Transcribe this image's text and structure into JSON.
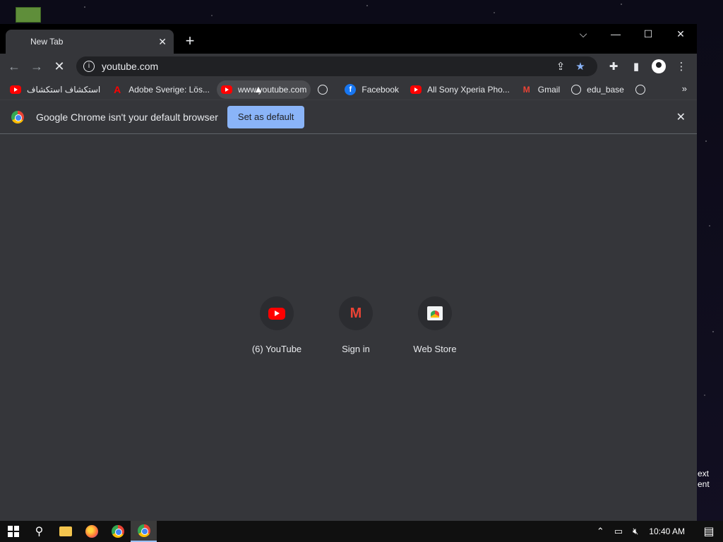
{
  "tab": {
    "title": "New Tab",
    "close": "✕"
  },
  "newtab": "+",
  "window_controls": {
    "menu": "⌵",
    "minimize": "—",
    "maximize": "☐",
    "close": "✕"
  },
  "nav": {
    "back": "←",
    "forward": "→",
    "stop": "✕"
  },
  "omnibox": {
    "url": "youtube.com"
  },
  "bookmarks": [
    {
      "label": "استکشاف استکشاف",
      "icon": "youtube-icon"
    },
    {
      "label": "Adobe Sverige: Lös...",
      "icon": "adobe-icon"
    },
    {
      "label": "www.youtube.com",
      "icon": "youtube-icon"
    },
    {
      "label": "",
      "icon": "globe-icon"
    },
    {
      "label": "Facebook",
      "icon": "facebook-icon"
    },
    {
      "label": "All Sony Xperia Pho...",
      "icon": "youtube-icon"
    },
    {
      "label": "Gmail",
      "icon": "gmail-icon"
    },
    {
      "label": "edu_base",
      "icon": "globe-icon"
    },
    {
      "label": "",
      "icon": "globe-icon"
    }
  ],
  "bookmarks_more": "»",
  "infobar": {
    "message": "Google Chrome isn't your default browser",
    "button": "Set as default",
    "close": "✕"
  },
  "shortcuts": [
    {
      "label": "(6) YouTube",
      "icon": "youtube-icon"
    },
    {
      "label": "Sign in",
      "icon": "gmail-icon"
    },
    {
      "label": "Web Store",
      "icon": "web-store-icon"
    }
  ],
  "taskbar": {
    "clock": "10:40 AM"
  },
  "desktop_peek": [
    "ext",
    "ent"
  ],
  "colors": {
    "accent": "#8ab4f8",
    "surface": "#35363a",
    "frame": "#000000"
  }
}
